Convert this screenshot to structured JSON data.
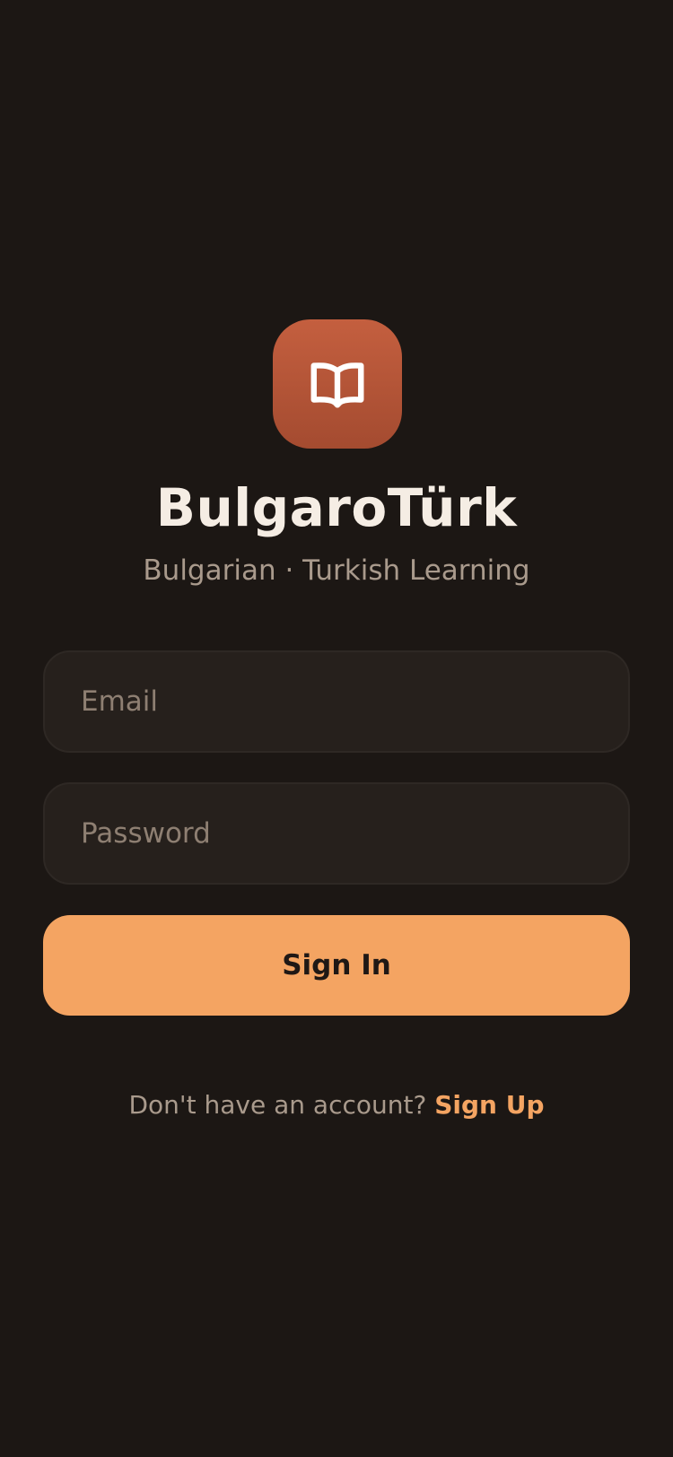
{
  "app": {
    "icon": "open-book-icon",
    "title": "BulgaroTürk",
    "subtitle": "Bulgarian · Turkish Learning"
  },
  "form": {
    "email_placeholder": "Email",
    "email_value": "",
    "password_placeholder": "Password",
    "password_value": "",
    "signin_label": "Sign In"
  },
  "footer": {
    "prompt": "Don't have an account?",
    "signup_label": "Sign Up"
  },
  "colors": {
    "background": "#1c1714",
    "accent": "#f4a462",
    "icon_tile": "#b5553a",
    "field_bg": "#26201c",
    "text_primary": "#f5ede4",
    "text_secondary": "#a99a8c"
  }
}
